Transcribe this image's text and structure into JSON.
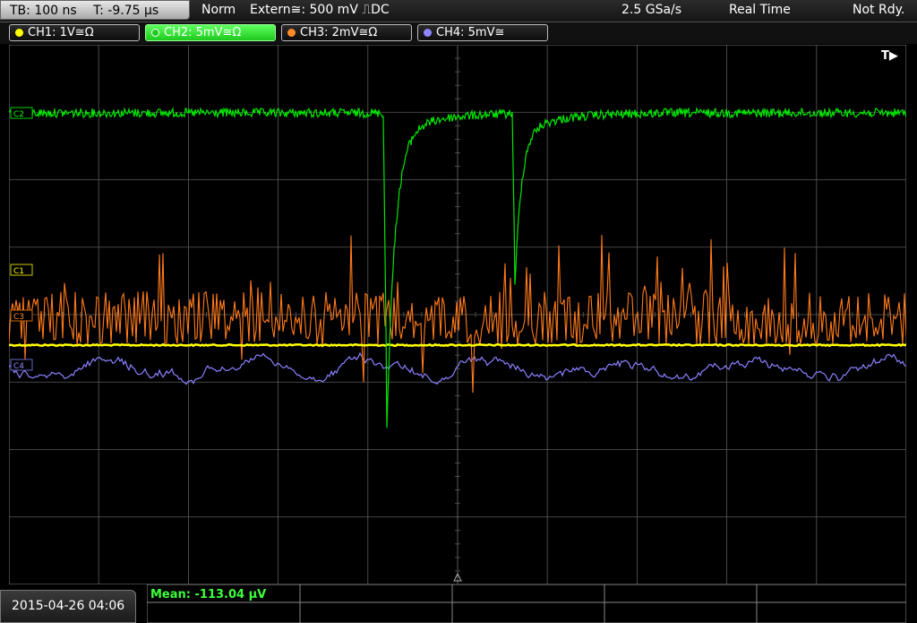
{
  "status_bar": {
    "timebase": "TB: 100 ns",
    "trigger_time": "T: -9.75 µs",
    "mode": "Norm",
    "trigger_source": "Extern≅: 500 mV ⎍DC",
    "sample_rate": "2.5 GSa/s",
    "acquisition": "Real Time",
    "state": "Not Rdy."
  },
  "channels": [
    {
      "label": "CH1: 1V≅Ω",
      "color": "#ffff00",
      "active": false
    },
    {
      "label": "CH2: 5mV≅Ω",
      "color": "#00ff00",
      "active": true
    },
    {
      "label": "CH3: 2mV≅Ω",
      "color": "#ff8c28",
      "active": false
    },
    {
      "label": "CH4: 5mV≅",
      "color": "#8f86ff",
      "active": false
    }
  ],
  "markers": {
    "c1": "C1",
    "c2": "C2",
    "c3": "C3",
    "c4": "C4",
    "trigger": "T▶"
  },
  "bottom": {
    "datetime": "2015-04-26 04:06",
    "measurement": "Mean: -113.04 µV"
  },
  "colors": {
    "grid": "#5a5a5a",
    "ch1": "#ffff00",
    "ch2": "#00e600",
    "ch3": "#ff7a1a",
    "ch4": "#8a80ff"
  }
}
